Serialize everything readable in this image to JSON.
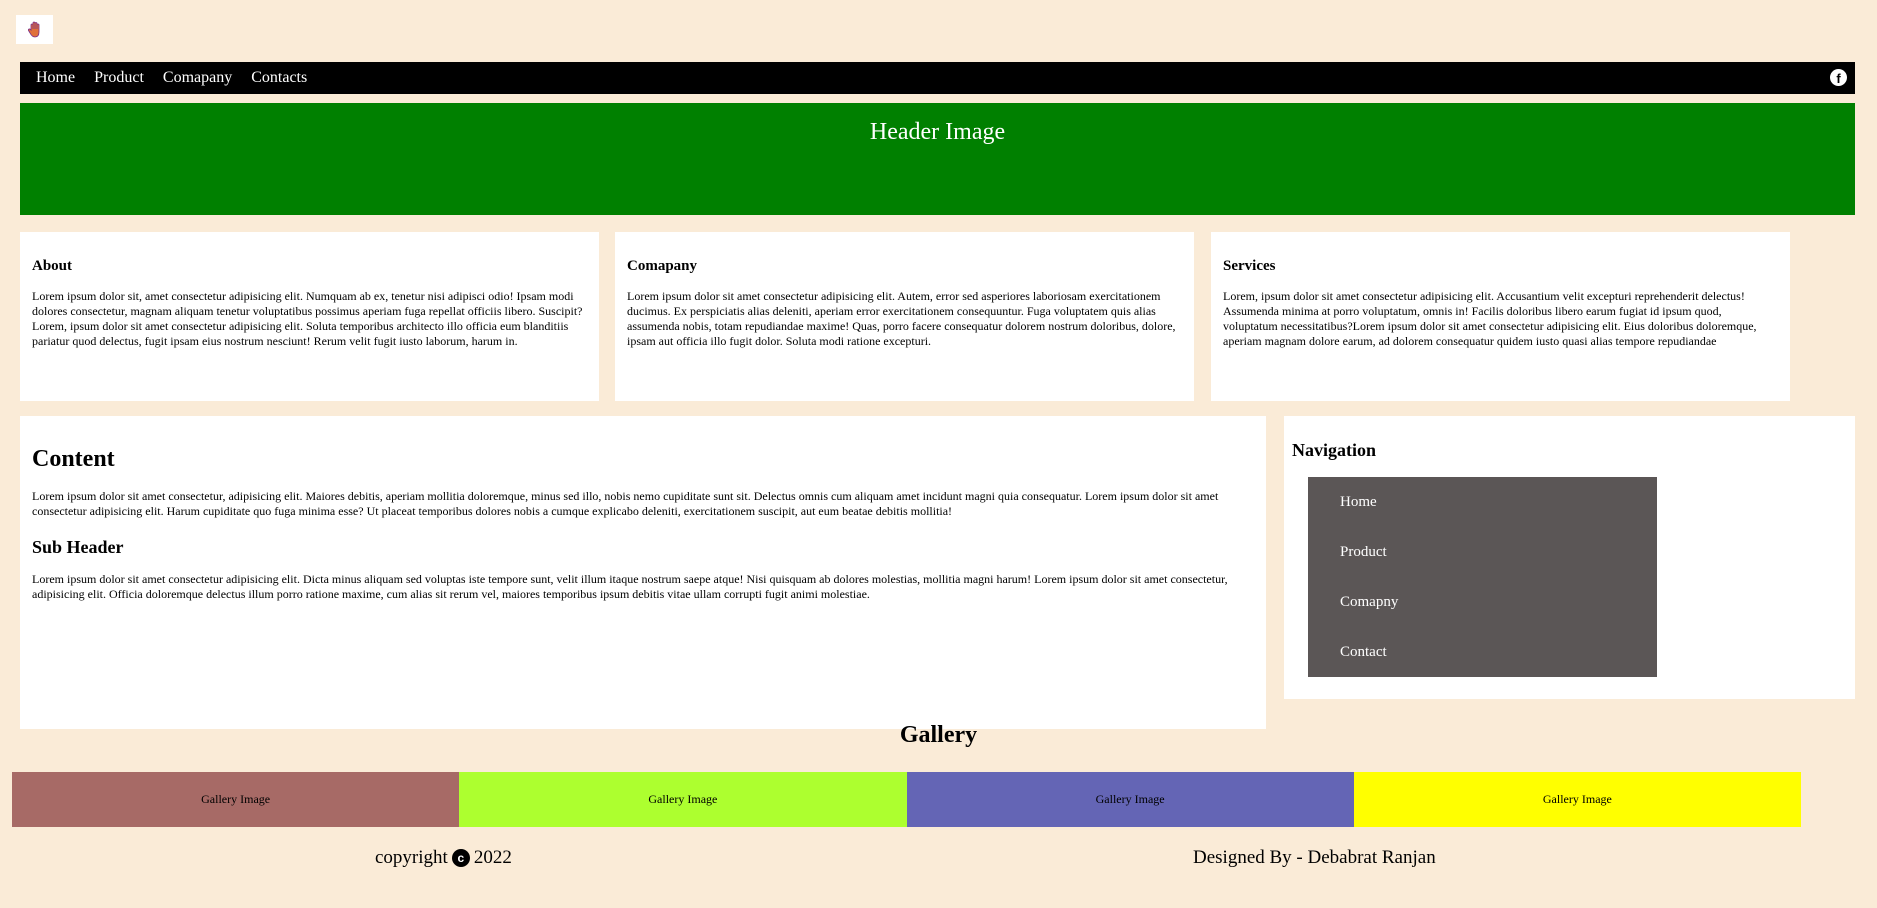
{
  "logo": {
    "icon": "hand-icon"
  },
  "topnav": {
    "items": [
      "Home",
      "Product",
      "Comapany",
      "Contacts"
    ],
    "social_icon": "facebook-icon"
  },
  "header": {
    "title": "Header Image",
    "bg_color": "#008000"
  },
  "cards": [
    {
      "title": "About",
      "text": "Lorem ipsum dolor sit, amet consectetur adipisicing elit. Numquam ab ex, tenetur nisi adipisci odio! Ipsam modi dolores consectetur, magnam aliquam tenetur voluptatibus possimus aperiam fuga repellat officiis libero. Suscipit?Lorem, ipsum dolor sit amet consectetur adipisicing elit. Soluta temporibus architecto illo officia eum blanditiis pariatur quod delectus, fugit ipsam eius nostrum nesciunt! Rerum velit fugit iusto laborum, harum in."
    },
    {
      "title": "Comapany",
      "text": "Lorem ipsum dolor sit amet consectetur adipisicing elit. Autem, error sed asperiores laboriosam exercitationem ducimus. Ex perspiciatis alias deleniti, aperiam error exercitationem consequuntur. Fuga voluptatem quis alias assumenda nobis, totam repudiandae maxime! Quas, porro facere consequatur dolorem nostrum doloribus, dolore, ipsam aut officia illo fugit dolor. Soluta modi ratione excepturi."
    },
    {
      "title": "Services",
      "text": "Lorem, ipsum dolor sit amet consectetur adipisicing elit. Accusantium velit excepturi reprehenderit delectus! Assumenda minima at porro voluptatum, omnis in! Facilis doloribus libero earum fugiat id ipsum quod, voluptatum necessitatibus?Lorem ipsum dolor sit amet consectetur adipisicing elit. Eius doloribus doloremque, aperiam magnam dolore earum, ad dolorem consequatur quidem iusto quasi alias tempore repudiandae"
    }
  ],
  "content": {
    "title": "Content",
    "para1": "Lorem ipsum dolor sit amet consectetur, adipisicing elit. Maiores debitis, aperiam mollitia doloremque, minus sed illo, nobis nemo cupiditate sunt sit. Delectus omnis cum aliquam amet incidunt magni quia consequatur. Lorem ipsum dolor sit amet consectetur adipisicing elit. Harum cupiditate quo fuga minima esse? Ut placeat temporibus dolores nobis a cumque explicabo deleniti, exercitationem suscipit, aut eum beatae debitis mollitia!",
    "subheader": "Sub Header",
    "para2": "Lorem ipsum dolor sit amet consectetur adipisicing elit. Dicta minus aliquam sed voluptas iste tempore sunt, velit illum itaque nostrum saepe atque! Nisi quisquam ab dolores molestias, mollitia magni harum! Lorem ipsum dolor sit amet consectetur, adipisicing elit. Officia doloremque delectus illum porro ratione maxime, cum alias sit rerum vel, maiores temporibus ipsum debitis vitae ullam corrupti fugit animi molestiae."
  },
  "sidenav": {
    "title": "Navigation",
    "items": [
      "Home",
      "Product",
      "Comapny",
      "Contact"
    ]
  },
  "gallery": {
    "title": "Gallery",
    "items": [
      {
        "label": "Gallery Image",
        "color": "#a76a66"
      },
      {
        "label": "Gallery Image",
        "color": "#adff2f"
      },
      {
        "label": "Gallery Image",
        "color": "#6465b5"
      },
      {
        "label": "Gallery Image",
        "color": "#ffff00"
      }
    ]
  },
  "footer": {
    "copyright_prefix": "copyright",
    "copyright_icon": "copyright-icon",
    "year": "2022",
    "designed_by": "Designed By - Debabrat Ranjan"
  }
}
